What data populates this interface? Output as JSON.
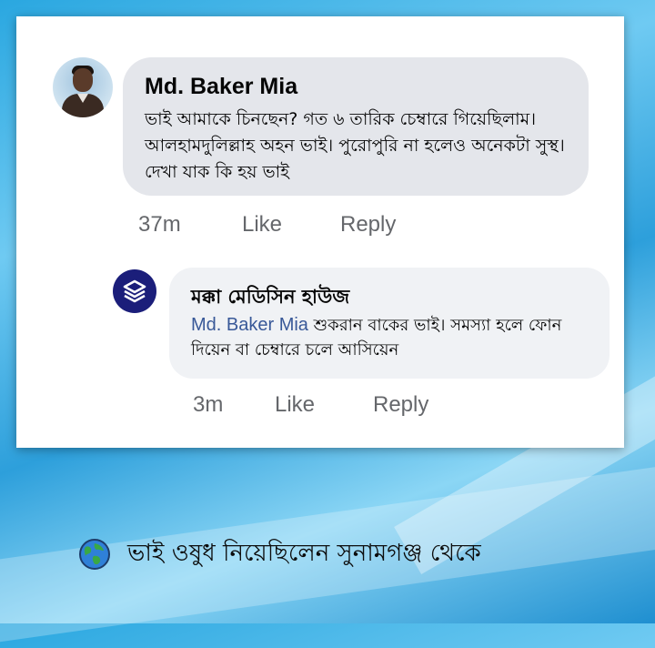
{
  "comment": {
    "author": "Md. Baker Mia",
    "text": "ভাই আমাকে চিনছেন? গত ৬ তারিক চেম্বারে গিয়েছিলাম। আলহামদুলিল্লাহ অহন ভাই। পুরোপুরি না হলেও অনেকটা সুস্থ। দেখা যাক কি হয় ভাই",
    "time": "37m",
    "like_label": "Like",
    "reply_label": "Reply"
  },
  "reply": {
    "author": "মক্কা মেডিসিন হাউজ",
    "mention": "Md. Baker Mia",
    "text": " শুকরান বাকের ভাই। সমস্যা হলে ফোন দিয়েন বা চেম্বারে চলে আসিয়েন",
    "time": "3m",
    "like_label": "Like",
    "reply_label": "Reply"
  },
  "caption": {
    "icon": "globe-icon",
    "text": "ভাই ওষুধ নিয়েছিলেন সুনামগঞ্জ থেকে"
  },
  "colors": {
    "bubble_primary": "#e4e6eb",
    "bubble_reply": "#f0f2f5",
    "action_text": "#65676b",
    "mention_link": "#385898",
    "page_logo_bg": "#1b1e7a"
  }
}
